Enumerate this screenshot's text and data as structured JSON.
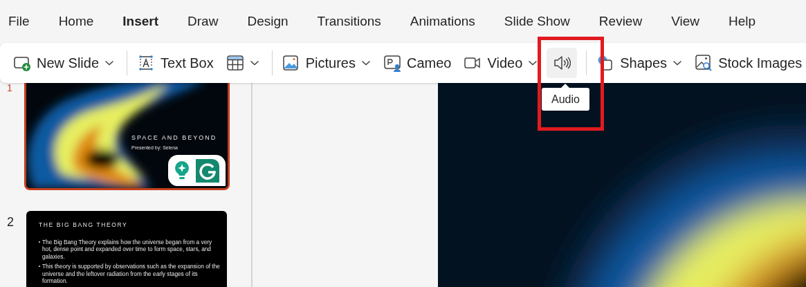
{
  "menu": {
    "tabs": [
      {
        "label": "File",
        "selected": false
      },
      {
        "label": "Home",
        "selected": false
      },
      {
        "label": "Insert",
        "selected": true
      },
      {
        "label": "Draw",
        "selected": false
      },
      {
        "label": "Design",
        "selected": false
      },
      {
        "label": "Transitions",
        "selected": false
      },
      {
        "label": "Animations",
        "selected": false
      },
      {
        "label": "Slide Show",
        "selected": false
      },
      {
        "label": "Review",
        "selected": false
      },
      {
        "label": "View",
        "selected": false
      },
      {
        "label": "Help",
        "selected": false
      }
    ]
  },
  "ribbon": {
    "items": [
      {
        "kind": "button",
        "label": "New Slide",
        "dropdown": true,
        "hovered": false
      },
      {
        "kind": "separator"
      },
      {
        "kind": "button",
        "label": "Text Box",
        "dropdown": false,
        "hovered": false
      },
      {
        "kind": "button",
        "dropdown": true,
        "hovered": false
      },
      {
        "kind": "separator"
      },
      {
        "kind": "button",
        "label": "Pictures",
        "dropdown": true,
        "hovered": false
      },
      {
        "kind": "button",
        "label": "Cameo",
        "dropdown": false,
        "hovered": false
      },
      {
        "kind": "button",
        "label": "Video",
        "dropdown": true,
        "hovered": false
      },
      {
        "kind": "button",
        "dropdown": false,
        "hovered": true
      },
      {
        "kind": "separator"
      },
      {
        "kind": "button",
        "label": "Shapes",
        "dropdown": true,
        "hovered": false
      },
      {
        "kind": "button",
        "label": "Stock Images",
        "dropdown": false,
        "hovered": false
      }
    ]
  },
  "tooltip": {
    "text": "Audio"
  },
  "slides": [
    {
      "number": "1",
      "selected": true,
      "kind": "title",
      "title": "SPACE AND BEYOND",
      "subtitle": "Presented by: Selena"
    },
    {
      "number": "2",
      "selected": false,
      "kind": "bullets",
      "title": "THE BIG BANG THEORY",
      "bullets": [
        "The Big Bang Theory explains how the universe began from a very hot, dense point and expanded over time to form space, stars, and galaxies.",
        "This theory is supported by observations such as the expansion of the universe and the leftover radiation from the early stages of its formation."
      ]
    }
  ]
}
